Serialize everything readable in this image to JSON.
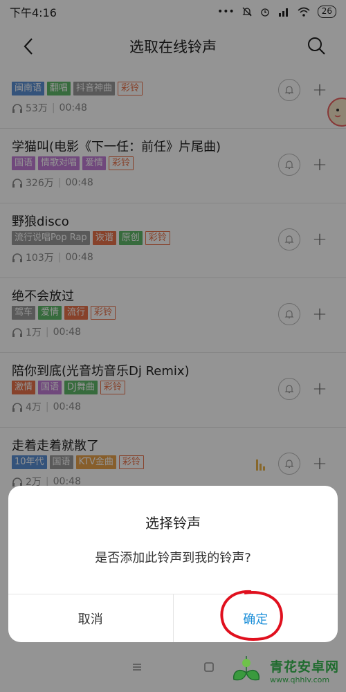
{
  "statusbar": {
    "time": "下午4:16",
    "battery": "26",
    "icons": [
      "dots-icon",
      "mute-icon",
      "alarm-icon",
      "signal-icon",
      "wifi-icon",
      "battery-icon"
    ]
  },
  "navbar": {
    "title": "选取在线铃声"
  },
  "songs": [
    {
      "title": "",
      "tags": [
        {
          "text": "闽南语",
          "color": "#5b8fd4"
        },
        {
          "text": "翻唱",
          "color": "#5fb86a"
        },
        {
          "text": "抖音神曲",
          "color": "#9a9a9a"
        }
      ],
      "ringtone_tag": "彩铃",
      "plays": "53万",
      "duration": "00:48",
      "playing": false
    },
    {
      "title": "学猫叫(电影《下一任：前任》片尾曲)",
      "tags": [
        {
          "text": "国语",
          "color": "#c27dd6"
        },
        {
          "text": "情歌对唱",
          "color": "#c27dd6"
        },
        {
          "text": "爱情",
          "color": "#c27dd6"
        }
      ],
      "ringtone_tag": "彩铃",
      "plays": "326万",
      "duration": "00:48",
      "playing": false
    },
    {
      "title": "野狼disco",
      "tags": [
        {
          "text": "流行说唱Pop Rap",
          "color": "#9a9a9a"
        },
        {
          "text": "诙谐",
          "color": "#e8734b"
        },
        {
          "text": "原创",
          "color": "#5fb86a"
        }
      ],
      "ringtone_tag": "彩铃",
      "plays": "103万",
      "duration": "00:48",
      "playing": false
    },
    {
      "title": "绝不会放过",
      "tags": [
        {
          "text": "驾车",
          "color": "#9a9a9a"
        },
        {
          "text": "爱情",
          "color": "#5fb86a"
        },
        {
          "text": "流行",
          "color": "#e8734b"
        }
      ],
      "ringtone_tag": "彩铃",
      "plays": "1万",
      "duration": "00:48",
      "playing": false
    },
    {
      "title": "陪你到底(光音坊音乐Dj Remix)",
      "tags": [
        {
          "text": "激情",
          "color": "#e8734b"
        },
        {
          "text": "国语",
          "color": "#c27dd6"
        },
        {
          "text": "DJ舞曲",
          "color": "#5fb86a"
        }
      ],
      "ringtone_tag": "彩铃",
      "plays": "4万",
      "duration": "00:48",
      "playing": false
    },
    {
      "title": "走着走着就散了",
      "tags": [
        {
          "text": "10年代",
          "color": "#5b8fd4"
        },
        {
          "text": "国语",
          "color": "#9a9a9a"
        },
        {
          "text": "KTV金曲",
          "color": "#e8a24b"
        }
      ],
      "ringtone_tag": "彩铃",
      "plays": "2万",
      "duration": "00:48",
      "playing": true
    }
  ],
  "dialog": {
    "title": "选择铃声",
    "message": "是否添加此铃声到我的铃声?",
    "cancel_label": "取消",
    "ok_label": "确定"
  },
  "watermark": {
    "main": "青花安卓网",
    "sub": "www.qhhlv.com"
  },
  "colors": {
    "accent": "#1a8ed8",
    "annotation": "#e0101e",
    "ringtone_tag": "#e8734b"
  }
}
